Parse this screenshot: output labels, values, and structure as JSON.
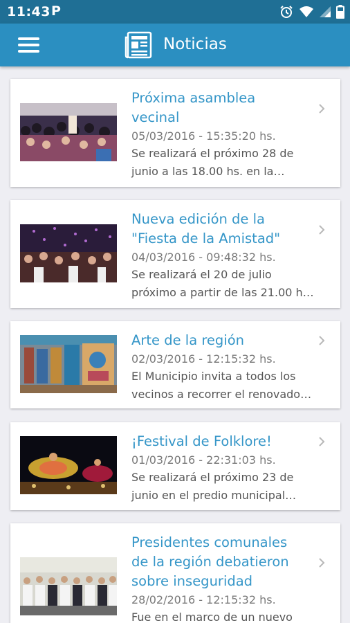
{
  "status_bar": {
    "time": "11:43",
    "notification_letter": "P"
  },
  "header": {
    "title": "Noticias",
    "icon": "newspaper-icon",
    "menu_icon": "hamburger-menu-icon"
  },
  "news": [
    {
      "title_lines": [
        "Próxima asamblea",
        "vecinal"
      ],
      "date": "05/03/2016 - 15:35:20 hs.",
      "summary_lines": [
        "Se realizará el próximo 28 de",
        "junio a las 18.00 hs. en la…"
      ]
    },
    {
      "title_lines": [
        "Nueva edición de la",
        "\"Fiesta de la Amistad\""
      ],
      "date": "04/03/2016 - 09:48:32 hs.",
      "summary_lines": [
        "Se realizará el 20 de julio",
        "próximo a partir de las 21.00 h…"
      ]
    },
    {
      "title_lines": [
        "Arte de la región"
      ],
      "date": "02/03/2016 - 12:15:32 hs.",
      "summary_lines": [
        "El Municipio invita a todos los",
        "vecinos a recorrer el renovado…"
      ]
    },
    {
      "title_lines": [
        "¡Festival de Folklore!"
      ],
      "date": "01/03/2016 - 22:31:03 hs.",
      "summary_lines": [
        "Se realizará el próximo 23 de",
        "junio en el predio municipal…"
      ]
    },
    {
      "title_lines": [
        "Presidentes comunales",
        "de la región debatieron",
        "sobre inseguridad"
      ],
      "date": "28/02/2016 - 12:15:32 hs.",
      "summary_lines": [
        "Fue en el marco de un nuevo"
      ]
    }
  ],
  "colors": {
    "status_bar": "#1f6f95",
    "app_bar": "#2b8fc1",
    "title_text": "#3596c8",
    "background": "#eeeef3"
  }
}
